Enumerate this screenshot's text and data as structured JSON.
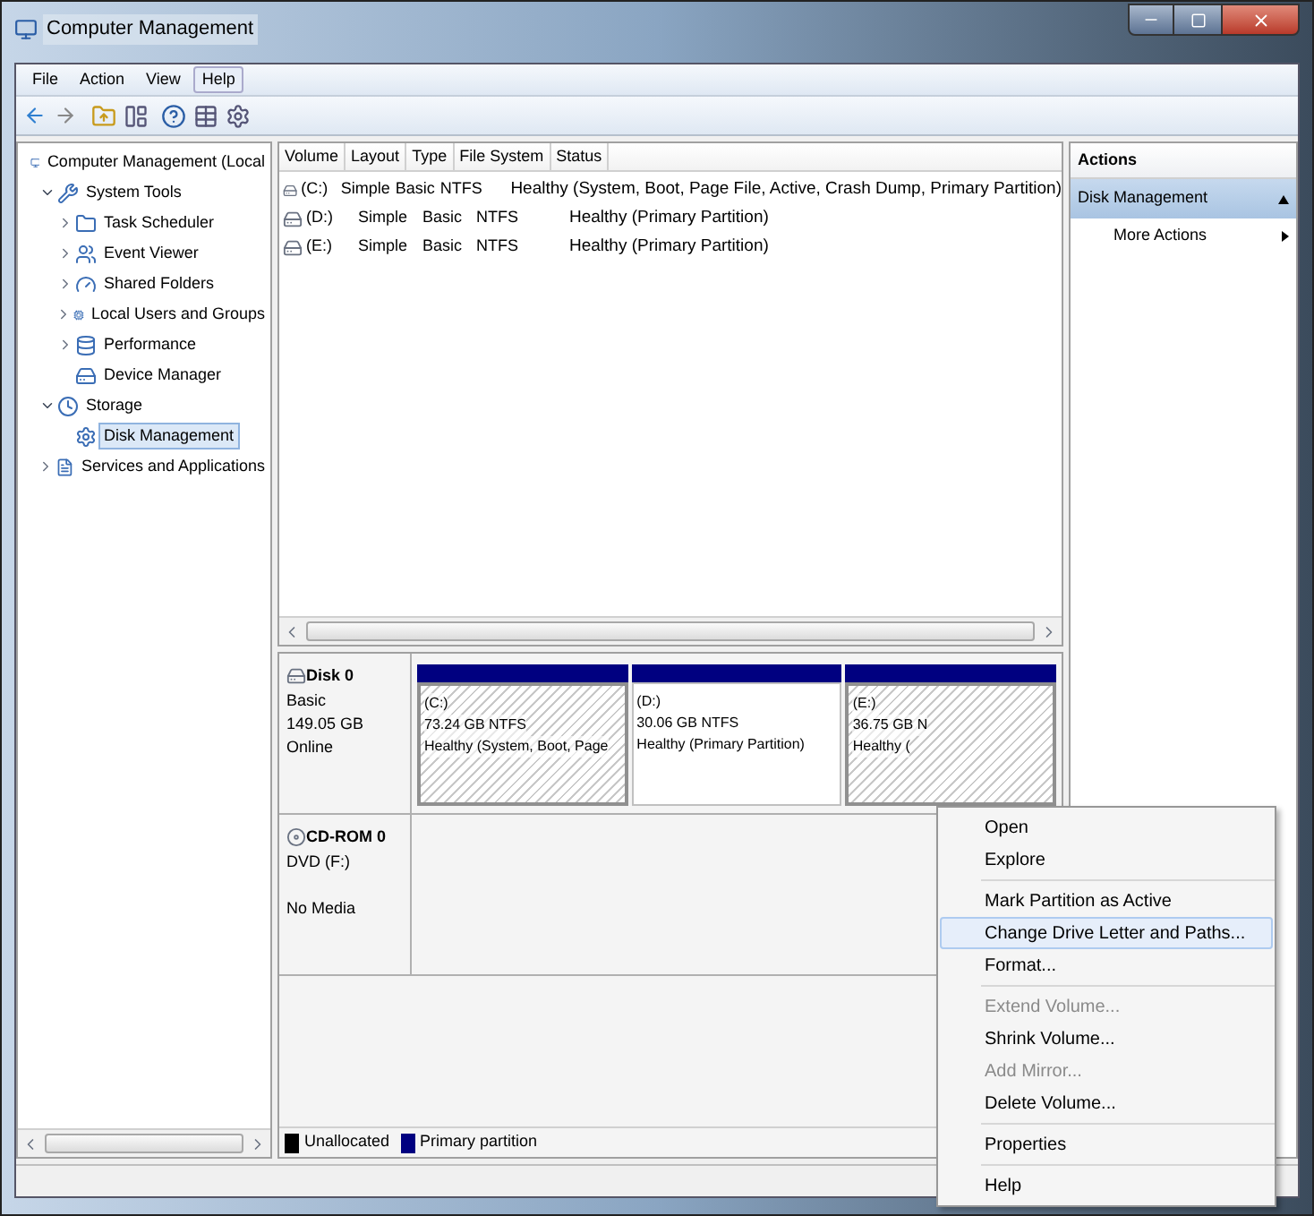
{
  "window": {
    "title": "Computer Management"
  },
  "menu": [
    {
      "label": "File",
      "selected": false
    },
    {
      "label": "Action",
      "selected": false
    },
    {
      "label": "View",
      "selected": false
    },
    {
      "label": "Help",
      "selected": true
    }
  ],
  "tree": [
    {
      "label": "Computer Management (Local",
      "selected": false,
      "children": [
        {
          "label": "System Tools",
          "selected": false,
          "expanded": true,
          "children": [
            {
              "label": "Task Scheduler",
              "selected": false,
              "expanded": false
            },
            {
              "label": "Event Viewer",
              "selected": false,
              "expanded": false
            },
            {
              "label": "Shared Folders",
              "selected": false,
              "expanded": false
            },
            {
              "label": "Local Users and Groups",
              "selected": false,
              "expanded": false
            },
            {
              "label": "Performance",
              "selected": false,
              "expanded": false
            },
            {
              "label": "Device Manager",
              "selected": false
            }
          ]
        },
        {
          "label": "Storage",
          "selected": false,
          "expanded": true,
          "children": [
            {
              "label": "Disk Management",
              "selected": true
            }
          ]
        },
        {
          "label": "Services and Applications",
          "selected": false,
          "expanded": false
        }
      ]
    }
  ],
  "volumes": {
    "columns": [
      "Volume",
      "Layout",
      "Type",
      "File System",
      "Status"
    ],
    "rows": [
      [
        "(C:)",
        "Simple",
        "Basic",
        "NTFS",
        "Healthy (System, Boot, Page File, Active, Crash Dump, Primary Partition)"
      ],
      [
        "(D:)",
        "Simple",
        "Basic",
        "NTFS",
        "Healthy (Primary Partition)"
      ],
      [
        "(E:)",
        "Simple",
        "Basic",
        "NTFS",
        "Healthy (Primary Partition)"
      ]
    ]
  },
  "disks": [
    {
      "kind": "disk",
      "name": "Disk 0",
      "lines": [
        "Basic",
        "149.05 GB"
      ],
      "status": "Online",
      "partitions": [
        {
          "name": "(C:)",
          "size": "73.24 GB NTFS",
          "status": "Healthy (System, Boot, Page",
          "selected": true
        },
        {
          "name": "(D:)",
          "size": "30.06 GB NTFS",
          "status": "Healthy (Primary Partition)",
          "selected": false
        },
        {
          "name": "(E:)",
          "size": "36.75 GB N",
          "status": "Healthy (",
          "selected": true
        }
      ]
    },
    {
      "kind": "cdrom",
      "name": "CD-ROM 0",
      "lines": [
        "DVD (F:)"
      ],
      "status": "No Media"
    }
  ],
  "legend": [
    {
      "label": "Unallocated",
      "color": "#000000"
    },
    {
      "label": "Primary partition",
      "color": "#000080"
    }
  ],
  "actions": {
    "title": "Actions",
    "section": "Disk Management",
    "expanded": true,
    "items": [
      "More Actions"
    ]
  },
  "context_menu": [
    {
      "kind": "item",
      "label": "Open",
      "selected": false,
      "disabled": false
    },
    {
      "kind": "item",
      "label": "Explore",
      "selected": false,
      "disabled": false
    },
    {
      "kind": "separator"
    },
    {
      "kind": "item",
      "label": "Mark Partition as Active",
      "selected": false,
      "disabled": false
    },
    {
      "kind": "item",
      "label": "Change Drive Letter and Paths...",
      "selected": true,
      "disabled": false
    },
    {
      "kind": "item",
      "label": "Format...",
      "selected": false,
      "disabled": false
    },
    {
      "kind": "separator"
    },
    {
      "kind": "item",
      "label": "Extend Volume...",
      "selected": false,
      "disabled": true
    },
    {
      "kind": "item",
      "label": "Shrink Volume...",
      "selected": false,
      "disabled": false
    },
    {
      "kind": "item",
      "label": "Add Mirror...",
      "selected": false,
      "disabled": true
    },
    {
      "kind": "item",
      "label": "Delete Volume...",
      "selected": false,
      "disabled": false
    },
    {
      "kind": "separator"
    },
    {
      "kind": "item",
      "label": "Properties",
      "selected": false,
      "disabled": false
    },
    {
      "kind": "separator"
    },
    {
      "kind": "item",
      "label": "Help",
      "selected": false,
      "disabled": false
    }
  ]
}
